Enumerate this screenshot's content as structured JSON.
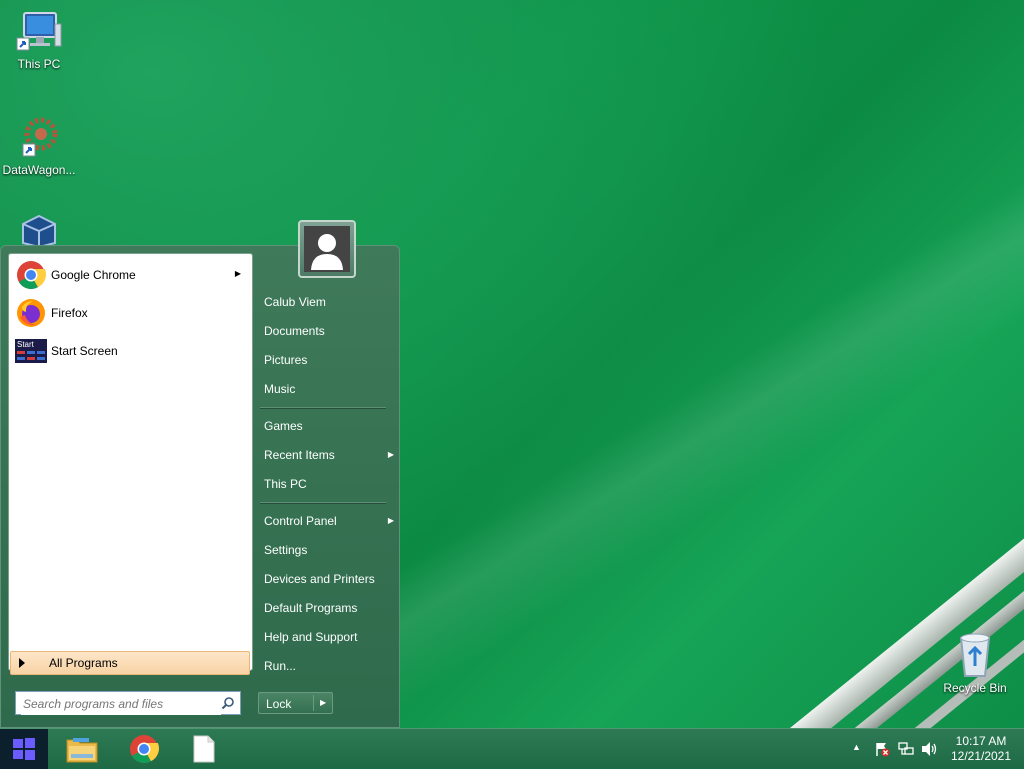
{
  "desktop": {
    "icons": [
      {
        "label": "This PC",
        "icon": "computer-icon"
      },
      {
        "label": "DataWagon...",
        "icon": "datawagon-icon"
      },
      {
        "label": "",
        "icon": "virtualbox-icon"
      },
      {
        "label": "Recycle Bin",
        "icon": "recycle-bin-icon"
      }
    ]
  },
  "start_menu": {
    "pinned": [
      {
        "label": "Google Chrome",
        "icon": "chrome-icon",
        "has_submenu": true
      },
      {
        "label": "Firefox",
        "icon": "firefox-icon",
        "has_submenu": false
      },
      {
        "label": "Start Screen",
        "icon": "start-screen-icon",
        "icon_text": "Start",
        "has_submenu": false
      }
    ],
    "all_programs_label": "All Programs",
    "search_placeholder": "Search programs and files",
    "user_name": "Calub Viem",
    "right_items": [
      {
        "label": "Calub Viem"
      },
      {
        "label": "Documents"
      },
      {
        "label": "Pictures"
      },
      {
        "label": "Music"
      },
      {
        "label": "Games"
      },
      {
        "label": "Recent Items",
        "has_submenu": true
      },
      {
        "label": "This PC"
      },
      {
        "label": "Control Panel",
        "has_submenu": true
      },
      {
        "label": "Settings"
      },
      {
        "label": "Devices and Printers"
      },
      {
        "label": "Default Programs"
      },
      {
        "label": "Help and Support"
      },
      {
        "label": "Run..."
      }
    ],
    "lock_label": "Lock"
  },
  "taskbar": {
    "pinned": [
      "file-explorer-icon",
      "chrome-icon",
      "blank-document-icon"
    ],
    "tray": [
      "show-hidden-icons",
      "action-center-flag-icon",
      "network-icon",
      "volume-icon"
    ],
    "time": "10:17 AM",
    "date": "12/21/2021"
  },
  "colors": {
    "desktop_green": "#0c8a43",
    "start_menu_bg": "#3a7555",
    "all_programs_highlight": "#f8d3a4",
    "taskbar": "#246f4b"
  }
}
